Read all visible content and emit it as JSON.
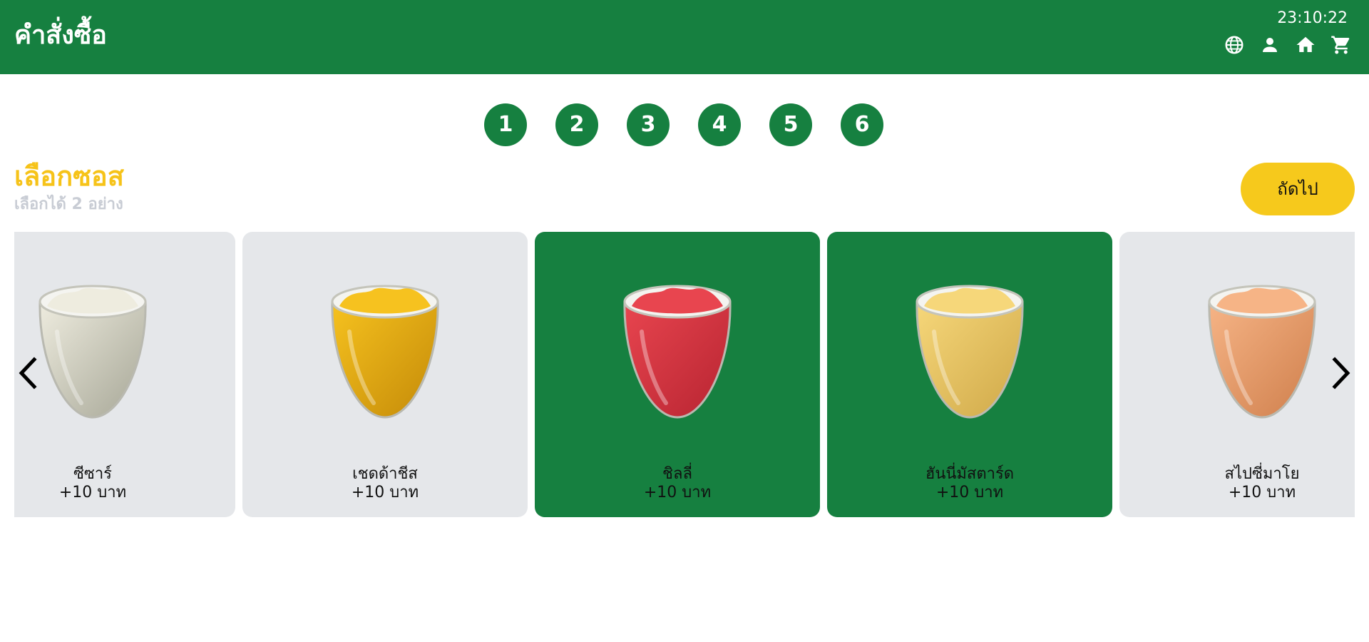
{
  "header": {
    "title": "คำสั่งซื้อ",
    "clock": "23:10:22",
    "icons": [
      "globe-icon",
      "user-icon",
      "home-icon",
      "cart-icon"
    ]
  },
  "steps": [
    "1",
    "2",
    "3",
    "4",
    "5",
    "6"
  ],
  "section": {
    "title": "เลือกซอส",
    "subtitle": "เลือกได้ 2 อย่าง",
    "next_label": "ถัดไป"
  },
  "sauces": [
    {
      "name": "ซีซาร์",
      "price": "+10 บาท",
      "selected": false,
      "color": "#eeecdf",
      "shade": "#a6a696"
    },
    {
      "name": "เชดด้าชีส",
      "price": "+10 บาท",
      "selected": false,
      "color": "#f6c21f",
      "shade": "#c48a08"
    },
    {
      "name": "ชิลลี่",
      "price": "+10 บาท",
      "selected": true,
      "color": "#e8454f",
      "shade": "#b72431"
    },
    {
      "name": "ฮันนี่มัสตาร์ด",
      "price": "+10 บาท",
      "selected": true,
      "color": "#f6d77a",
      "shade": "#cfa848"
    },
    {
      "name": "สไปซี่มาโย",
      "price": "+10 บาท",
      "selected": false,
      "color": "#f6b486",
      "shade": "#cf7f4c"
    }
  ],
  "colors": {
    "brand_green": "#168040",
    "accent_yellow": "#f6c91c",
    "card_grey": "#e5e7ea"
  }
}
